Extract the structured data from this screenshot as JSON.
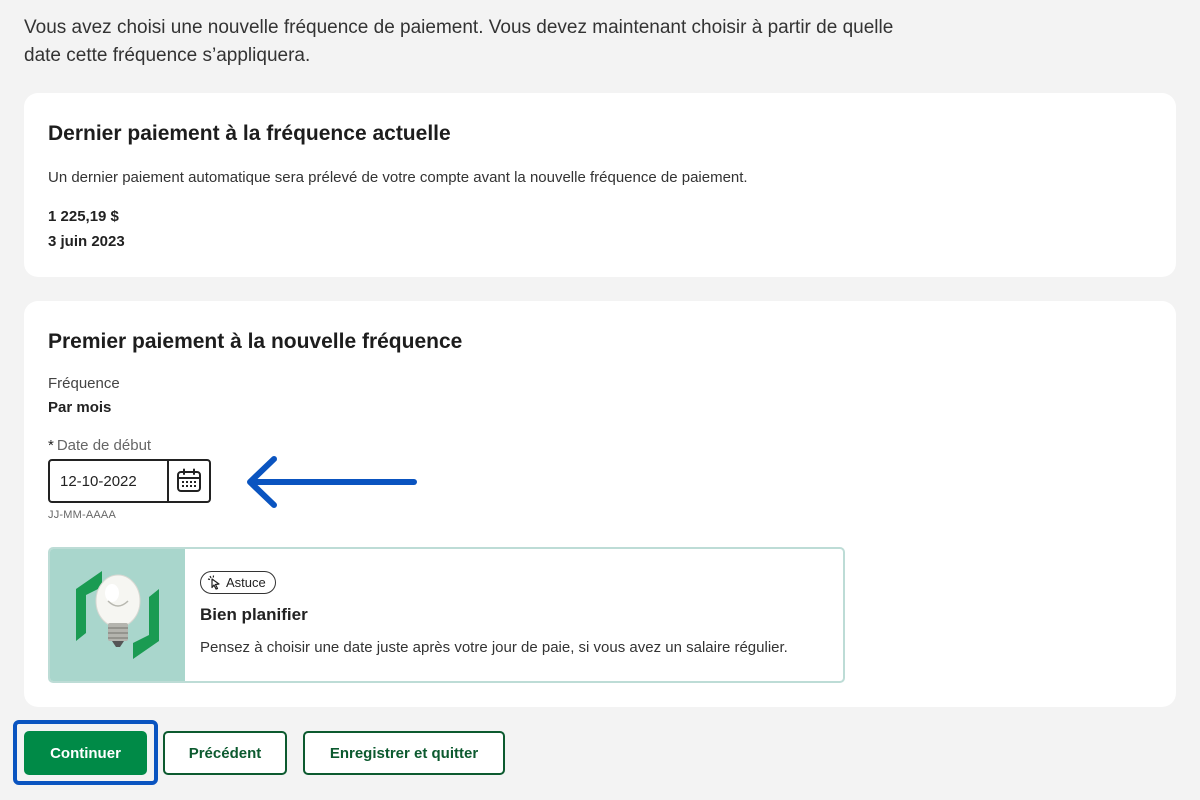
{
  "intro": {
    "text": "Vous avez choisi une nouvelle fréquence de paiement. Vous devez maintenant choisir à partir de quelle date cette fréquence s’appliquera."
  },
  "last_payment": {
    "title": "Dernier paiement à la fréquence actuelle",
    "description": "Un dernier paiement automatique sera prélevé de votre compte avant la nouvelle fréquence de paiement.",
    "amount": "1 225,19 $",
    "date": "3 juin 2023"
  },
  "first_payment": {
    "title": "Premier paiement à la nouvelle fréquence",
    "frequency_label": "Fréquence",
    "frequency_value": "Par mois",
    "required_marker": "*",
    "start_date_label": "Date de début",
    "start_date_value": "12-10-2022",
    "start_date_hint": "JJ-MM-AAAA",
    "calendar_icon": "calendar-icon",
    "annotation_arrow_color": "#0a54c0"
  },
  "tip": {
    "badge": "Astuce",
    "badge_icon": "sparkle-pointer-icon",
    "title": "Bien planifier",
    "text": "Pensez à choisir une date juste après votre jour de paie, si vous avez un salaire régulier.",
    "image_icon": "lightbulb-icon"
  },
  "actions": {
    "continue": "Continuer",
    "previous": "Précédent",
    "save_quit": "Enregistrer et quitter"
  },
  "colors": {
    "primary": "#008a47",
    "secondary_text": "#0c5a2f",
    "focus": "#0a54c0",
    "tip_bg": "#a9d6cc"
  }
}
